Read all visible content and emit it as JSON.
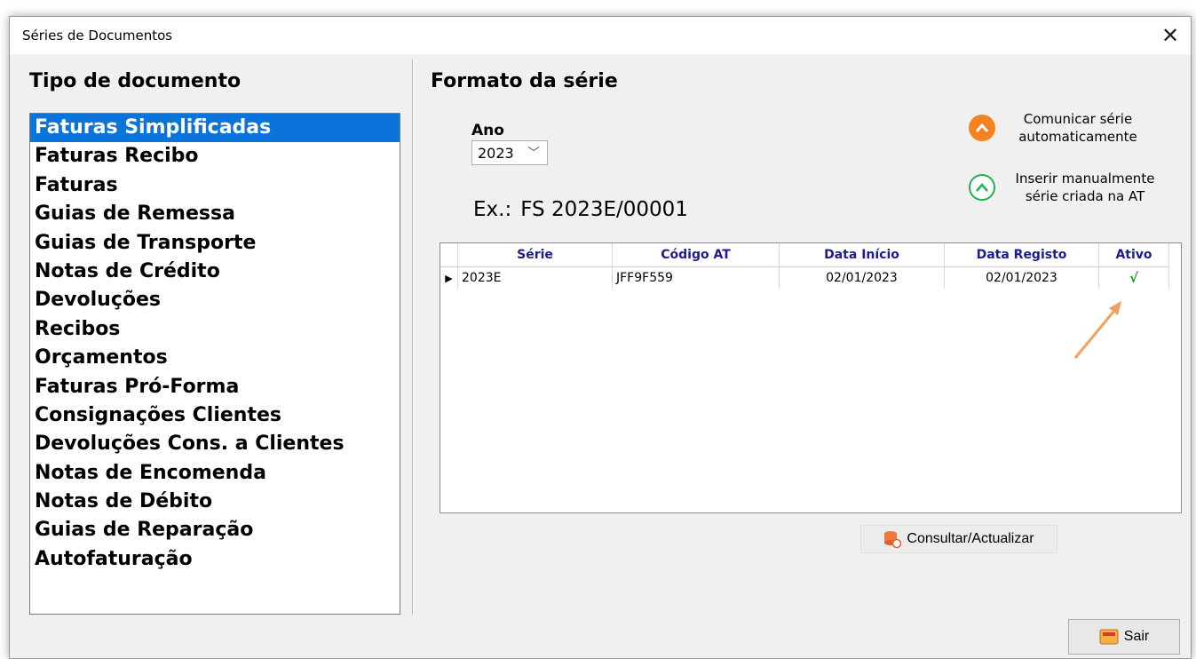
{
  "window": {
    "title": "Séries de Documentos",
    "close_glyph": "✕"
  },
  "left_panel": {
    "title": "Tipo de documento",
    "items": [
      "Faturas Simplificadas",
      "Faturas Recibo",
      "Faturas",
      "Guias de Remessa",
      "Guias de Transporte",
      "Notas de Crédito",
      "Devoluções",
      "Recibos",
      "Orçamentos",
      "Faturas Pró-Forma",
      "Consignações Clientes",
      "Devoluções Cons. a Clientes",
      "Notas de Encomenda",
      "Notas de Débito",
      "Guias de Reparação",
      "Autofaturação"
    ],
    "selected_index": 0
  },
  "right_panel": {
    "title": "Formato da série",
    "ano_label": "Ano",
    "ano_value": "2023",
    "example_prefix": "Ex.:",
    "example_value": "FS 2023E/00001",
    "option_auto": "Comunicar série automaticamente",
    "option_manual": "Inserir manualmente série criada na AT"
  },
  "grid": {
    "columns": [
      "Série",
      "Código AT",
      "Data Início",
      "Data Registo",
      "Ativo"
    ],
    "rows": [
      {
        "serie": "2023E",
        "codigo": "JFF9F559",
        "inicio": "02/01/2023",
        "registo": "02/01/2023",
        "ativo": "√"
      }
    ]
  },
  "buttons": {
    "consultar": "Consultar/Actualizar",
    "sair": "Sair"
  },
  "colors": {
    "selection": "#0a74da",
    "header_text": "#1c1c8f",
    "orange_icon": "#f5821f",
    "green_icon": "#22b14c",
    "arrow": "#f0a060"
  },
  "icons": {
    "close": "close-icon",
    "orange_option": "chevron-up-filled-icon",
    "green_option": "chevron-up-outline-icon",
    "consultar": "database-refresh-icon",
    "sair": "exit-icon"
  }
}
